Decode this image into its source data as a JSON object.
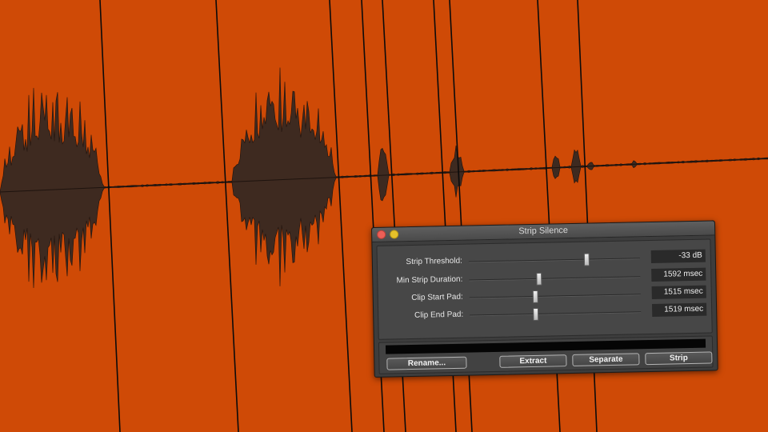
{
  "theme": {
    "track_color": "#cf4a06",
    "waveform_color": "#3e2a20",
    "clip_line_color": "#0b0b0b"
  },
  "dialog": {
    "title": "Strip Silence",
    "controls": [
      {
        "label": "Strip Threshold:",
        "value": "-33 dB",
        "level": 0.68
      },
      {
        "label": "Min Strip Duration:",
        "value": "1592 msec",
        "level": 0.4
      },
      {
        "label": "Clip Start Pad:",
        "value": "1515 msec",
        "level": 0.38
      },
      {
        "label": "Clip End Pad:",
        "value": "1519 msec",
        "level": 0.38
      }
    ],
    "buttons": {
      "rename": "Rename...",
      "extract": "Extract",
      "separate": "Separate",
      "strip": "Strip"
    }
  }
}
